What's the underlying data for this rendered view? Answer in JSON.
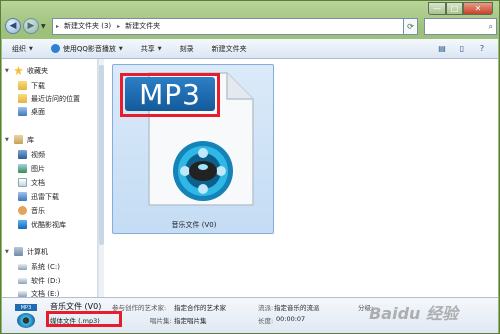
{
  "window": {
    "min": "—",
    "max": "□",
    "close": "✕"
  },
  "address": {
    "root_arrow": "▸",
    "segments": [
      "新建文件夹 (3)",
      "新建文件夹"
    ],
    "seg_arrow": "▸",
    "search_icon": "search-icon"
  },
  "toolbar": {
    "organize": "组织",
    "qq_play": "使用QQ影音播放",
    "share": "共享",
    "burn": "刻录",
    "new_folder": "新建文件夹",
    "dropdown": "▼"
  },
  "sidebar": {
    "favorites": {
      "label": "收藏夹",
      "items": [
        "下载",
        "最近访问的位置",
        "桌面"
      ]
    },
    "libraries": {
      "label": "库",
      "items": [
        "视频",
        "图片",
        "文档",
        "迅雷下载",
        "音乐",
        "优酷影视库"
      ]
    },
    "computer": {
      "label": "计算机",
      "items": [
        "系统 (C:)",
        "软件 (D:)",
        "文档 (E:)"
      ]
    }
  },
  "file": {
    "badge": "MP3",
    "name": "音乐文件 (V0)"
  },
  "details": {
    "thumb_badge": "MP3",
    "name": "音乐文件 (V0)",
    "type": "媒体文件 (.mp3)",
    "contrib_label": "参与创作的艺术家:",
    "contrib_value": "指定合作的艺术家",
    "album_label": "唱片集:",
    "album_value": "指定唱片集",
    "genre_label": "流派:",
    "genre_value": "指定音乐的流派",
    "length_label": "长度:",
    "length_value": "00:00:07",
    "rating_label": "分级:",
    "watermark": "Baidu 经验"
  }
}
